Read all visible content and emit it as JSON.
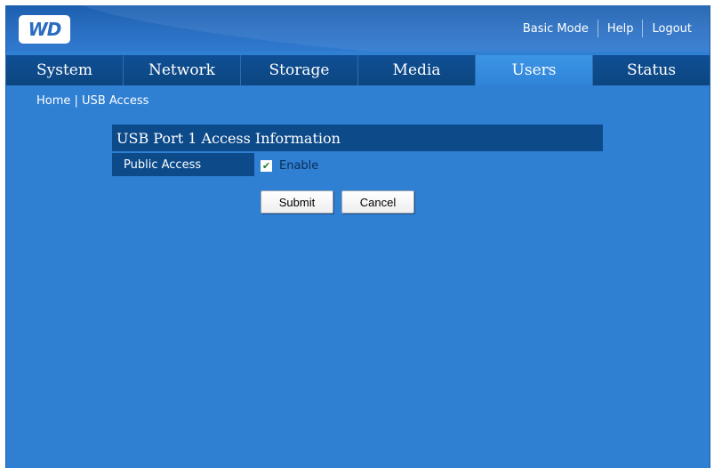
{
  "header": {
    "logo_text": "WD",
    "links": [
      "Basic Mode",
      "Help",
      "Logout"
    ]
  },
  "nav": {
    "tabs": [
      {
        "label": "System"
      },
      {
        "label": "Network"
      },
      {
        "label": "Storage"
      },
      {
        "label": "Media"
      },
      {
        "label": "Users"
      },
      {
        "label": "Status"
      }
    ],
    "active": "Users"
  },
  "breadcrumb": {
    "home": "Home",
    "separator": " | ",
    "current": "USB Access"
  },
  "panel": {
    "title": "USB Port 1 Access Information",
    "public_access_label": "Public Access",
    "enable_label": "Enable",
    "enable_checked": true,
    "checkmark": "✔"
  },
  "buttons": {
    "submit": "Submit",
    "cancel": "Cancel"
  },
  "colors": {
    "background": "#2f7fd2",
    "dark_blue": "#0c4a8a",
    "active_tab": "#3d95e6"
  }
}
